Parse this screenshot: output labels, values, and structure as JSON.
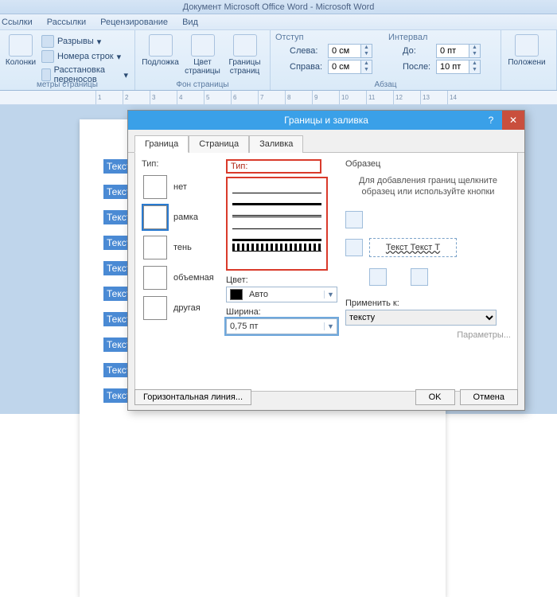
{
  "titlebar": "Документ Microsoft Office Word  -  Microsoft Word",
  "menu": {
    "links": "Ссылки",
    "mailings": "Рассылки",
    "review": "Рецензирование",
    "view": "Вид"
  },
  "ribbon": {
    "columns_label": "Колонки",
    "breaks": "Разрывы",
    "line_numbers": "Номера строк",
    "hyphenation": "Расстановка переносов",
    "group_page": "метры страницы",
    "watermark": "Подложка",
    "page_color": "Цвет страницы",
    "page_borders": "Границы страниц",
    "group_bg": "Фон страницы",
    "indent_header": "Отступ",
    "indent_left_label": "Слева:",
    "indent_left_value": "0 см",
    "indent_right_label": "Справа:",
    "indent_right_value": "0 см",
    "spacing_header": "Интервал",
    "spacing_before_label": "До:",
    "spacing_before_value": "0 пт",
    "spacing_after_label": "После:",
    "spacing_after_value": "10 пт",
    "group_para": "Абзац",
    "position": "Положени"
  },
  "doc_lines": "Текст Те",
  "dialog": {
    "title": "Границы и заливка",
    "tabs": {
      "border": "Граница",
      "page": "Страница",
      "fill": "Заливка"
    },
    "type_header": "Тип:",
    "types": {
      "none": "нет",
      "box": "рамка",
      "shadow": "тень",
      "threeD": "объемная",
      "custom": "другая"
    },
    "style_header": "Тип:",
    "color_label": "Цвет:",
    "color_value": "Авто",
    "width_label": "Ширина:",
    "width_value": "0,75 пт",
    "preview_header": "Образец",
    "preview_msg": "Для добавления границ щелкните образец или используйте кнопки",
    "preview_sample": "Текст Текст Т",
    "apply_label": "Применить к:",
    "apply_value": "тексту",
    "params": "Параметры...",
    "hline": "Горизонтальная линия...",
    "ok": "OK",
    "cancel": "Отмена"
  }
}
